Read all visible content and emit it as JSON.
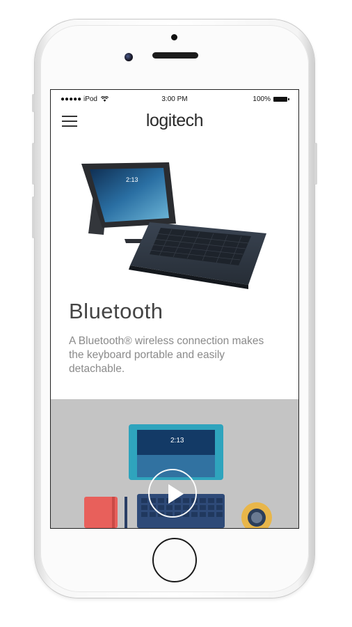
{
  "status_bar": {
    "carrier": "●●●●● iPod",
    "time": "3:00 PM",
    "battery": "100%"
  },
  "nav": {
    "brand": "logitech"
  },
  "hero": {
    "tablet_clock": "2:13"
  },
  "feature": {
    "title": "Bluetooth",
    "description": "A Bluetooth® wireless connection makes the keyboard portable and easily detachable."
  },
  "video": {
    "tablet_clock": "2:13"
  },
  "colors": {
    "accent_case": "#2fa4bd",
    "keyboard": "#2e4a78",
    "notebook": "#e8605b",
    "video_bg": "#c4c4c4"
  }
}
